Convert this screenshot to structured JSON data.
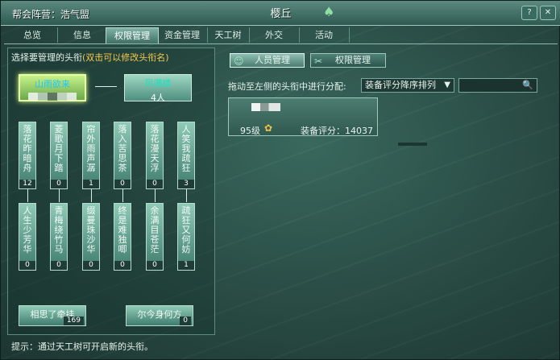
{
  "window": {
    "alliance": "帮会阵营：浩气盟",
    "title": "樱丘",
    "title_icon": "guild-emblem-icon",
    "help_glyph": "?",
    "close_glyph": "✕"
  },
  "tabs": [
    "总览",
    "信息",
    "权限管理",
    "资金管理",
    "天工树",
    "外交",
    "活动"
  ],
  "active_tab": "权限管理",
  "left": {
    "instruction": "选择要管理的头衔",
    "instruction_highlight": "(双击可以修改头衔名)",
    "leader": {
      "name": "山雨欲来"
    },
    "vice": {
      "name": "风满楼",
      "count": "4人"
    },
    "ranks_row1": [
      {
        "name": "落花昨暗舟",
        "count": "12"
      },
      {
        "name": "菱歌月下踏",
        "count": "0"
      },
      {
        "name": "帘外雨声潺",
        "count": "1"
      },
      {
        "name": "落入苦思茶",
        "count": "0"
      },
      {
        "name": "落花漫天浮",
        "count": "0"
      },
      {
        "name": "人笑我疏狂",
        "count": "3"
      }
    ],
    "ranks_row2": [
      {
        "name": "人生少芳华",
        "count": "0"
      },
      {
        "name": "青梅绕竹马",
        "count": "0"
      },
      {
        "name": "缀曼珠沙华",
        "count": "0"
      },
      {
        "name": "终是难独唧",
        "count": "0"
      },
      {
        "name": "余满目苍茫",
        "count": "0"
      },
      {
        "name": "疏狂又何妨",
        "count": "1"
      }
    ],
    "bottom_ranks": [
      {
        "name": "相思了牵挂",
        "count": "169"
      },
      {
        "name": "尔今身何方",
        "count": "0"
      }
    ],
    "hint": "提示：通过天工树可开启新的头衔。"
  },
  "right": {
    "subtabs": [
      {
        "label": "人员管理",
        "icon": "people-icon"
      },
      {
        "label": "权限管理",
        "icon": "tools-icon"
      }
    ],
    "assign_label": "拖动至左侧的头衔中进行分配:",
    "sort_selected": "装备评分降序排列",
    "search_value": "",
    "member": {
      "level": "95级",
      "class_icon": "class-icon",
      "score_label": "装备评分：",
      "score_value": "14037"
    }
  }
}
